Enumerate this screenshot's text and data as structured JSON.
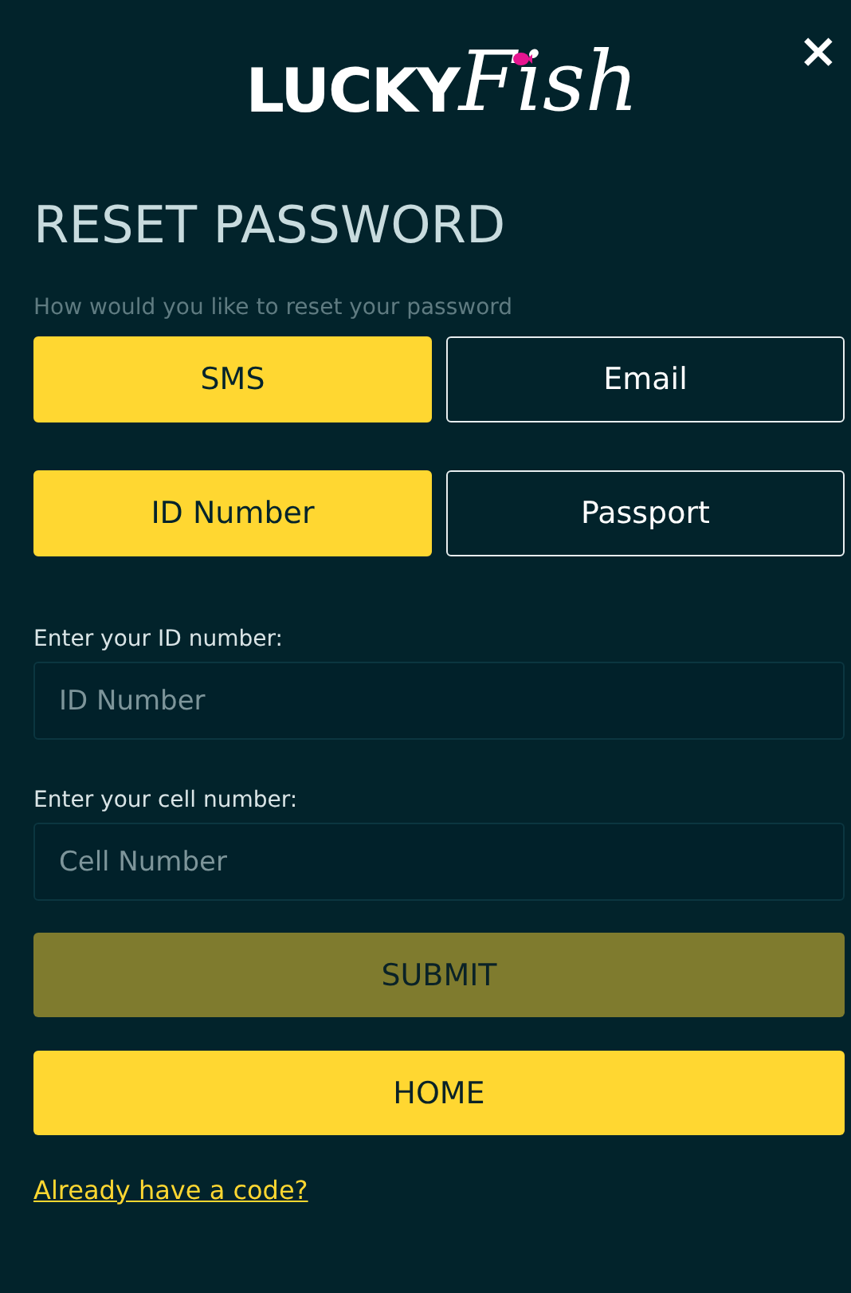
{
  "close_button": "×",
  "logo": {
    "word": "LUCKY",
    "script": "Fish"
  },
  "title": "RESET PASSWORD",
  "subtitle": "How would you like to reset your password",
  "option_groups": [
    {
      "options": [
        {
          "label": "SMS",
          "selected": true
        },
        {
          "label": "Email",
          "selected": false
        }
      ]
    },
    {
      "options": [
        {
          "label": "ID Number",
          "selected": true
        },
        {
          "label": "Passport",
          "selected": false
        }
      ]
    }
  ],
  "fields": [
    {
      "label": "Enter your ID number:",
      "placeholder": "ID Number"
    },
    {
      "label": "Enter your cell number:",
      "placeholder": "Cell Number"
    }
  ],
  "buttons": [
    {
      "label": "SUBMIT",
      "disabled": true
    },
    {
      "label": "HOME",
      "disabled": false
    }
  ],
  "link": "Already have a code?"
}
